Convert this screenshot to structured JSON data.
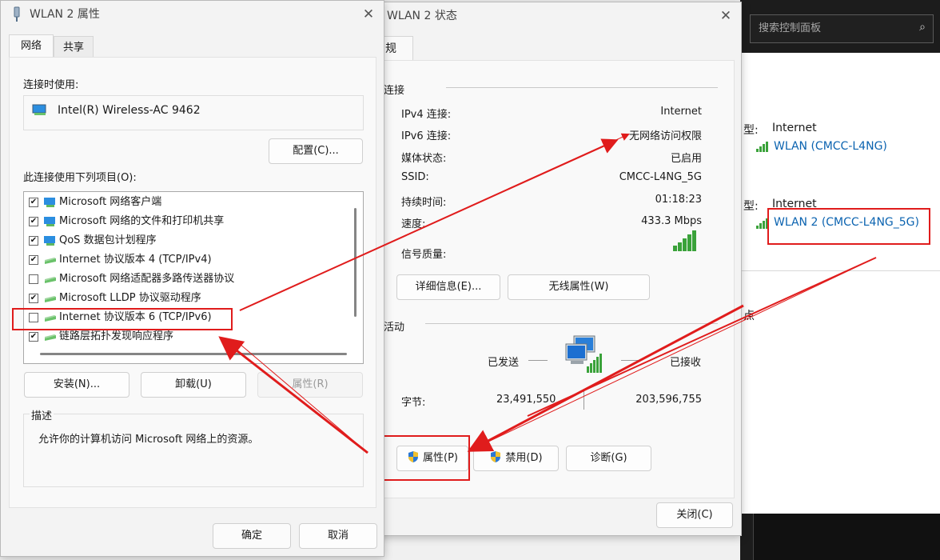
{
  "colors": {
    "accent": "#0b63b0",
    "annotation": "#e01c1c",
    "signal_green": "#3aa23a"
  },
  "control_panel": {
    "search_placeholder": "搜索控制面板",
    "search_icon": "search-icon",
    "networks": [
      {
        "type_label": "型:",
        "access_type": "Internet",
        "connection": "WLAN (CMCC-L4NG)"
      },
      {
        "type_label": "型:",
        "access_type": "Internet",
        "connection": "WLAN 2 (CMCC-L4NG_5G)"
      }
    ],
    "fragment_label": "点"
  },
  "status_window": {
    "title": "WLAN 2 状态",
    "tab_label": "规",
    "connection_section": "连接",
    "rows": [
      {
        "key": "IPv4 连接:",
        "value": "Internet"
      },
      {
        "key": "IPv6 连接:",
        "value": "无网络访问权限"
      },
      {
        "key": "媒体状态:",
        "value": "已启用"
      },
      {
        "key": "SSID:",
        "value": "CMCC-L4NG_5G"
      },
      {
        "key": "持续时间:",
        "value": "01:18:23"
      },
      {
        "key": "速度:",
        "value": "433.3 Mbps"
      }
    ],
    "signal_label": "信号质量:",
    "signal_level": 1.0,
    "details_button": "详细信息(E)...",
    "wireless_props_button": "无线属性(W)",
    "activity_section": "活动",
    "sent_label": "已发送",
    "received_label": "已接收",
    "bytes_label": "字节:",
    "bytes_sent": "23,491,550",
    "bytes_received": "203,596,755",
    "properties_button": "属性(P)",
    "disable_button": "禁用(D)",
    "diagnose_button": "诊断(G)",
    "close_button": "关闭(C)"
  },
  "properties_window": {
    "title": "WLAN 2 属性",
    "tabs": [
      "网络",
      "共享"
    ],
    "connect_using_label": "连接时使用:",
    "adapter_name": "Intel(R) Wireless-AC 9462",
    "configure_button": "配置(C)...",
    "items_label": "此连接使用下列项目(O):",
    "items": [
      {
        "label": "Microsoft 网络客户端",
        "checked": true,
        "icon": "network-client-icon"
      },
      {
        "label": "Microsoft 网络的文件和打印机共享",
        "checked": true,
        "icon": "file-sharing-icon"
      },
      {
        "label": "QoS 数据包计划程序",
        "checked": true,
        "icon": "qos-icon"
      },
      {
        "label": "Internet 协议版本 4 (TCP/IPv4)",
        "checked": true,
        "icon": "protocol-icon"
      },
      {
        "label": "Microsoft 网络适配器多路传送器协议",
        "checked": false,
        "icon": "protocol-icon"
      },
      {
        "label": "Microsoft LLDP 协议驱动程序",
        "checked": true,
        "icon": "protocol-icon"
      },
      {
        "label": "Internet 协议版本 6 (TCP/IPv6)",
        "checked": false,
        "icon": "protocol-icon"
      },
      {
        "label": "链路层拓扑发现响应程序",
        "checked": true,
        "icon": "protocol-icon"
      }
    ],
    "install_button": "安装(N)...",
    "uninstall_button": "卸载(U)",
    "properties_button": "属性(R)",
    "description_label": "描述",
    "description_text": "允许你的计算机访问 Microsoft 网络上的资源。",
    "ok_button": "确定",
    "cancel_button": "取消"
  }
}
